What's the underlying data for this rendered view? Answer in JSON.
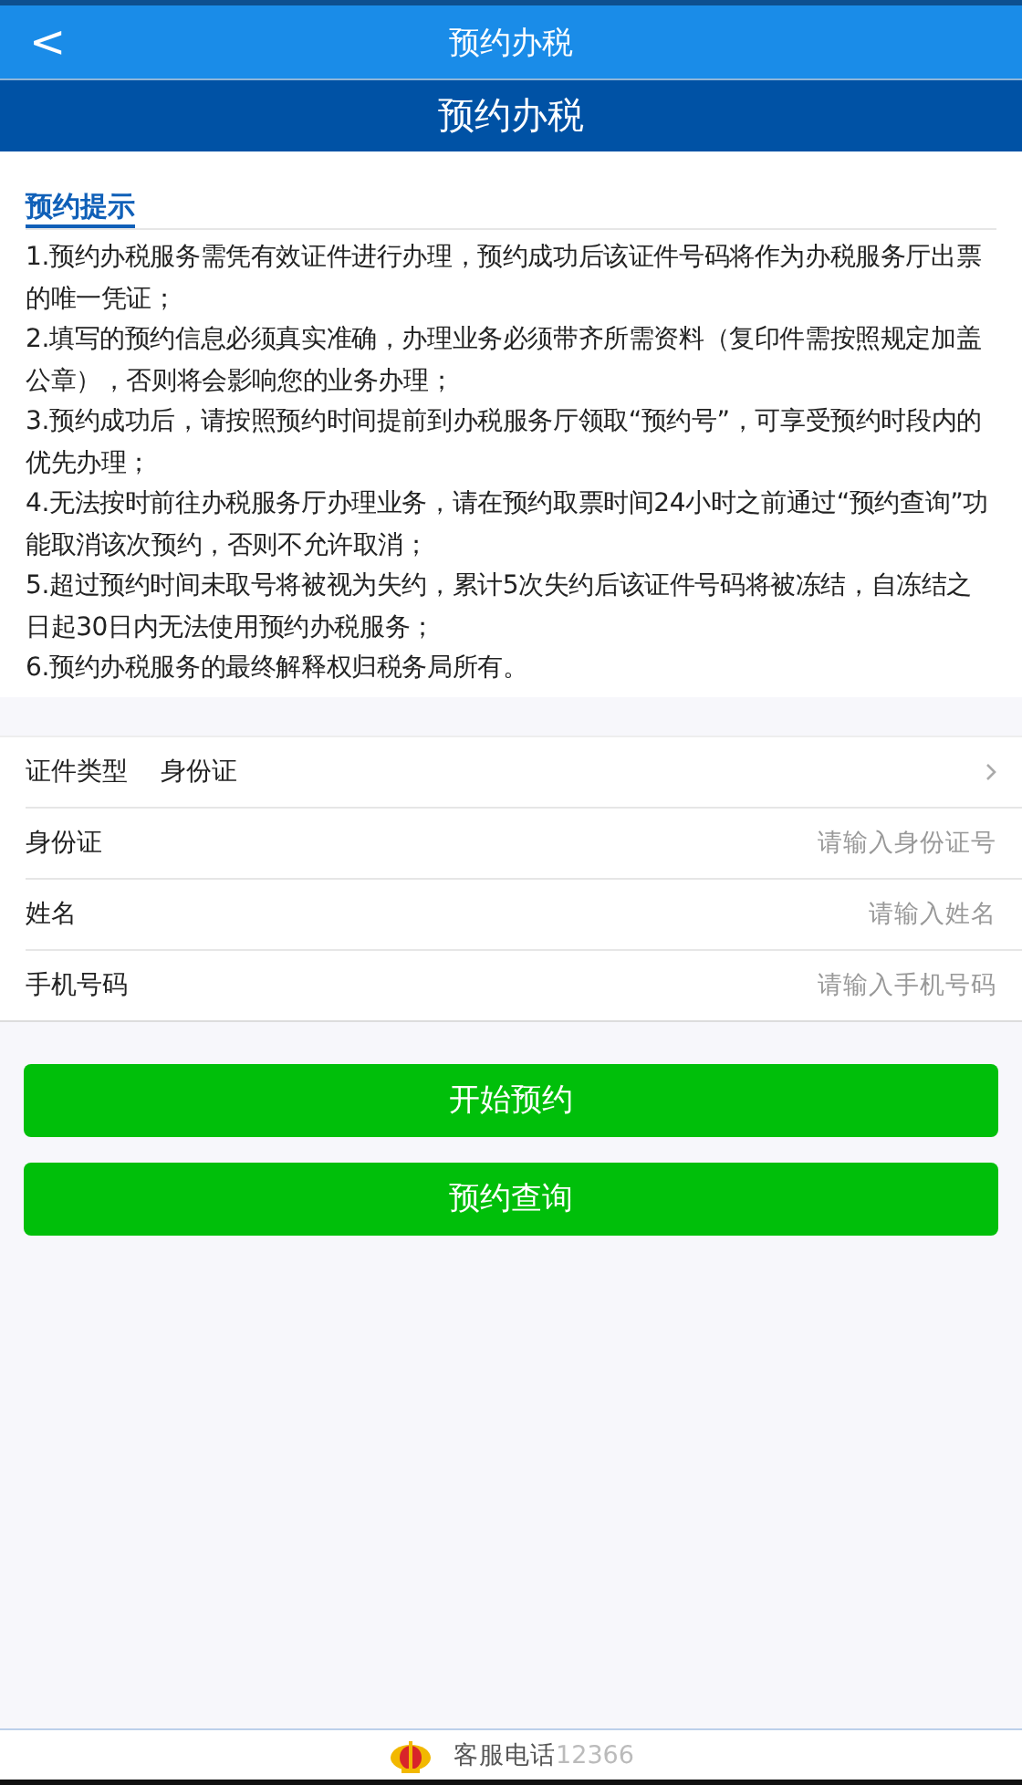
{
  "nav_bar": {
    "back": "<",
    "title": "预约办税"
  },
  "header": {
    "title": "预约办税"
  },
  "notice": {
    "title": "预约提示",
    "items": [
      "1.预约办税服务需凭有效证件进行办理，预约成功后该证件号码将作为办税服务厅出票的唯一凭证；",
      "2.填写的预约信息必须真实准确，办理业务必须带齐所需资料（复印件需按照规定加盖公章），否则将会影响您的业务办理；",
      "3.预约成功后，请按照预约时间提前到办税服务厅领取“预约号”，可享受预约时段内的优先办理；",
      "4.无法按时前往办税服务厅办理业务，请在预约取票时间24小时之前通过“预约查询”功能取消该次预约，否则不允许取消；",
      "5.超过预约时间未取号将被视为失约，累计5次失约后该证件号码将被冻结，自冻结之日起30日内无法使用预约办税服务；",
      "6.预约办税服务的最终解释权归税务局所有。"
    ]
  },
  "form": [
    {
      "kind": "select",
      "label": "证件类型",
      "value": "身份证"
    },
    {
      "kind": "input",
      "label": "身份证",
      "placeholder": "请输入身份证号"
    },
    {
      "kind": "input",
      "label": "姓名",
      "placeholder": "请输入姓名"
    },
    {
      "kind": "input",
      "label": "手机号码",
      "placeholder": "请输入手机号码"
    }
  ],
  "buttons": [
    "开始预约",
    "预约查询"
  ],
  "footer": {
    "label": "客服电话",
    "number": "12366"
  }
}
